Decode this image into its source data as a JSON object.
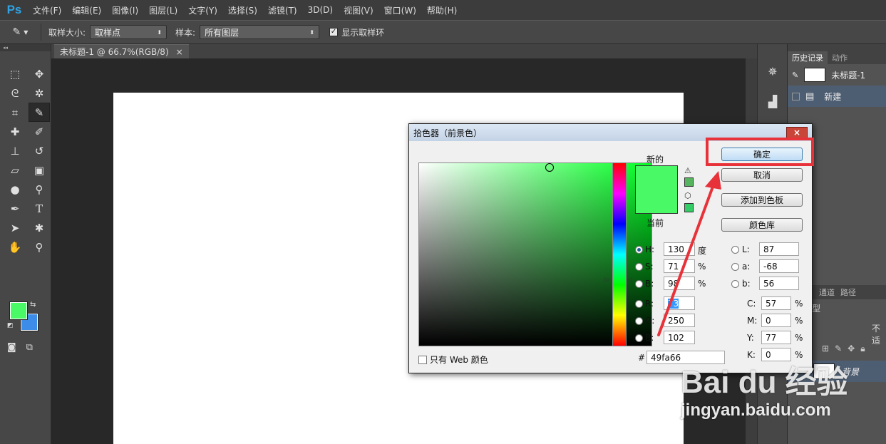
{
  "app": {
    "logo": "Ps"
  },
  "menu": [
    "文件(F)",
    "编辑(E)",
    "图像(I)",
    "图层(L)",
    "文字(Y)",
    "选择(S)",
    "滤镜(T)",
    "3D(D)",
    "视图(V)",
    "窗口(W)",
    "帮助(H)"
  ],
  "options": {
    "sample_size_label": "取样大小:",
    "sample_size_value": "取样点",
    "sample_label": "样本:",
    "sample_value": "所有图层",
    "show_ring_label": "显示取样环",
    "show_ring_checked": true
  },
  "document": {
    "tab_title": "未标题-1 @ 66.7%(RGB/8)",
    "close": "×"
  },
  "panels": {
    "tabs": [
      "历史记录",
      "动作"
    ],
    "history_snapshot": "未标题-1",
    "history_item": "新建",
    "lower_tabs": [
      "通道",
      "路径"
    ],
    "layer_name": "背景",
    "partial_labels": [
      "型",
      "不适"
    ]
  },
  "dialog": {
    "title": "拾色器（前景色）",
    "close": "×",
    "new_label": "新的",
    "current_label": "当前",
    "buttons": {
      "ok": "确定",
      "cancel": "取消",
      "add_swatch": "添加到色板",
      "libraries": "颜色库"
    },
    "fields": {
      "H": {
        "label": "H:",
        "value": "130",
        "unit": "度"
      },
      "S": {
        "label": "S:",
        "value": "71",
        "unit": "%"
      },
      "B": {
        "label": "B:",
        "value": "98",
        "unit": "%"
      },
      "R": {
        "label": "R:",
        "value": "73"
      },
      "G": {
        "label": "G:",
        "value": "250"
      },
      "Bb": {
        "label": "B:",
        "value": "102"
      },
      "L": {
        "label": "L:",
        "value": "87"
      },
      "a": {
        "label": "a:",
        "value": "-68"
      },
      "b": {
        "label": "b:",
        "value": "56"
      },
      "C": {
        "label": "C:",
        "value": "57",
        "unit": "%"
      },
      "M": {
        "label": "M:",
        "value": "0",
        "unit": "%"
      },
      "Y": {
        "label": "Y:",
        "value": "77",
        "unit": "%"
      },
      "K": {
        "label": "K:",
        "value": "0",
        "unit": "%"
      }
    },
    "hex_label": "#",
    "hex_value": "49fa66",
    "web_only_label": "只有 Web 颜色",
    "selected_radio": "H"
  },
  "colors": {
    "foreground": "#49fa66",
    "background": "#3d8de8",
    "annotation": "#e8323a"
  },
  "watermark": {
    "brand": "Bai du 经验",
    "url": "jingyan.baidu.com"
  }
}
